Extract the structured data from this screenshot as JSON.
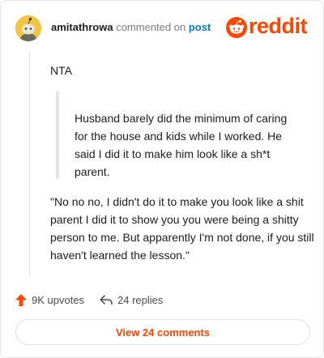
{
  "header": {
    "username": "amitathrowa",
    "action_text": "commented on",
    "post_link": "post",
    "logo_text": "reddit"
  },
  "comment": {
    "text": "NTA",
    "quote": "Husband barely did the minimum of caring for the house and kids while I worked. He said I did it to make him look like a sh*t parent.",
    "reply": "\"No no no, I didn't do it to make you look like a shit parent I did it to show you you were being a shitty person to me. But apparently I'm not done, if you still haven't learned the lesson.\""
  },
  "actions": {
    "upvotes": "9K upvotes",
    "replies": "24 replies"
  },
  "footer": {
    "view_button": "View 24 comments"
  },
  "colors": {
    "brand": "#ff4500",
    "link": "#0079d3",
    "avatar": "#f2c443"
  },
  "icons": {
    "upvote": "upvote-arrow-icon",
    "reply": "reply-arrow-icon",
    "avatar": "snoo-avatar-icon",
    "logo": "reddit-snoo-icon"
  }
}
